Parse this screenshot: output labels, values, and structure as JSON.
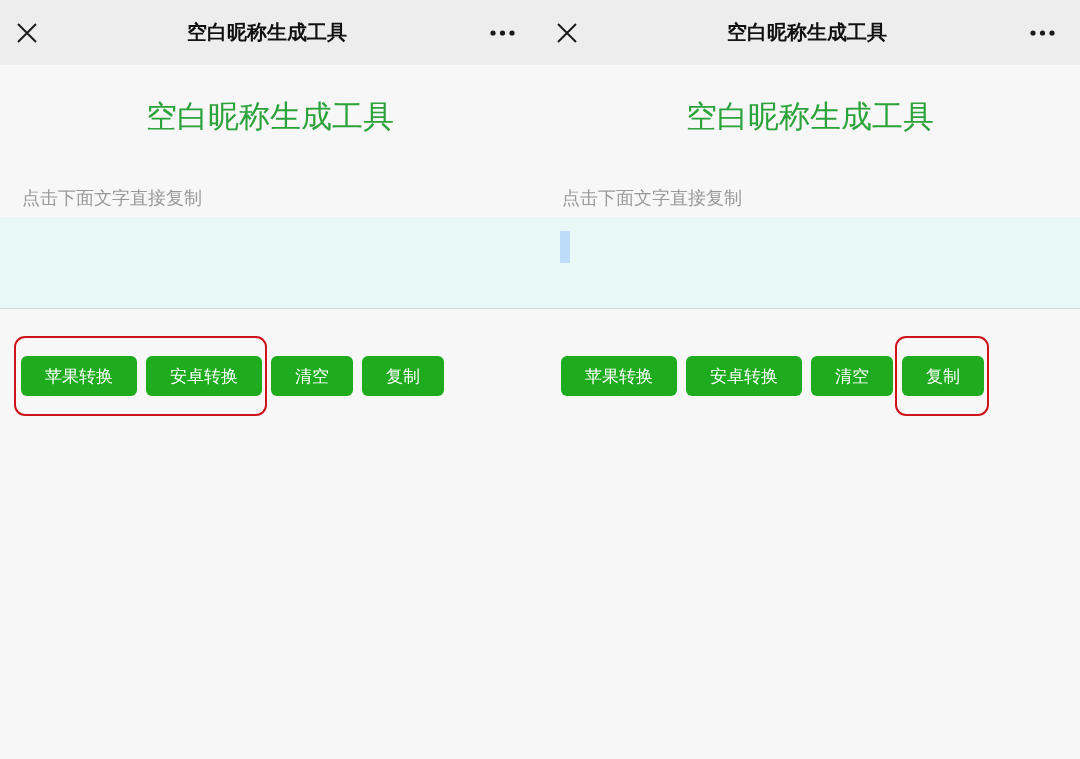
{
  "panels": [
    {
      "nav_bar": {
        "title": "空白昵称生成工具"
      },
      "heading": "空白昵称生成工具",
      "instruction": "点击下面文字直接复制",
      "output_box": {
        "selected": false
      },
      "buttons": [
        {
          "label": "苹果转换",
          "circled": true
        },
        {
          "label": "安卓转换",
          "circled": true
        },
        {
          "label": "清空",
          "circled": false
        },
        {
          "label": "复制",
          "circled": false
        }
      ]
    },
    {
      "nav_bar": {
        "title": "空白昵称生成工具"
      },
      "heading": "空白昵称生成工具",
      "instruction": "点击下面文字直接复制",
      "output_box": {
        "selected": true
      },
      "buttons": [
        {
          "label": "苹果转换",
          "circled": false
        },
        {
          "label": "安卓转换",
          "circled": false
        },
        {
          "label": "清空",
          "circled": false
        },
        {
          "label": "复制",
          "circled": true
        }
      ]
    }
  ]
}
